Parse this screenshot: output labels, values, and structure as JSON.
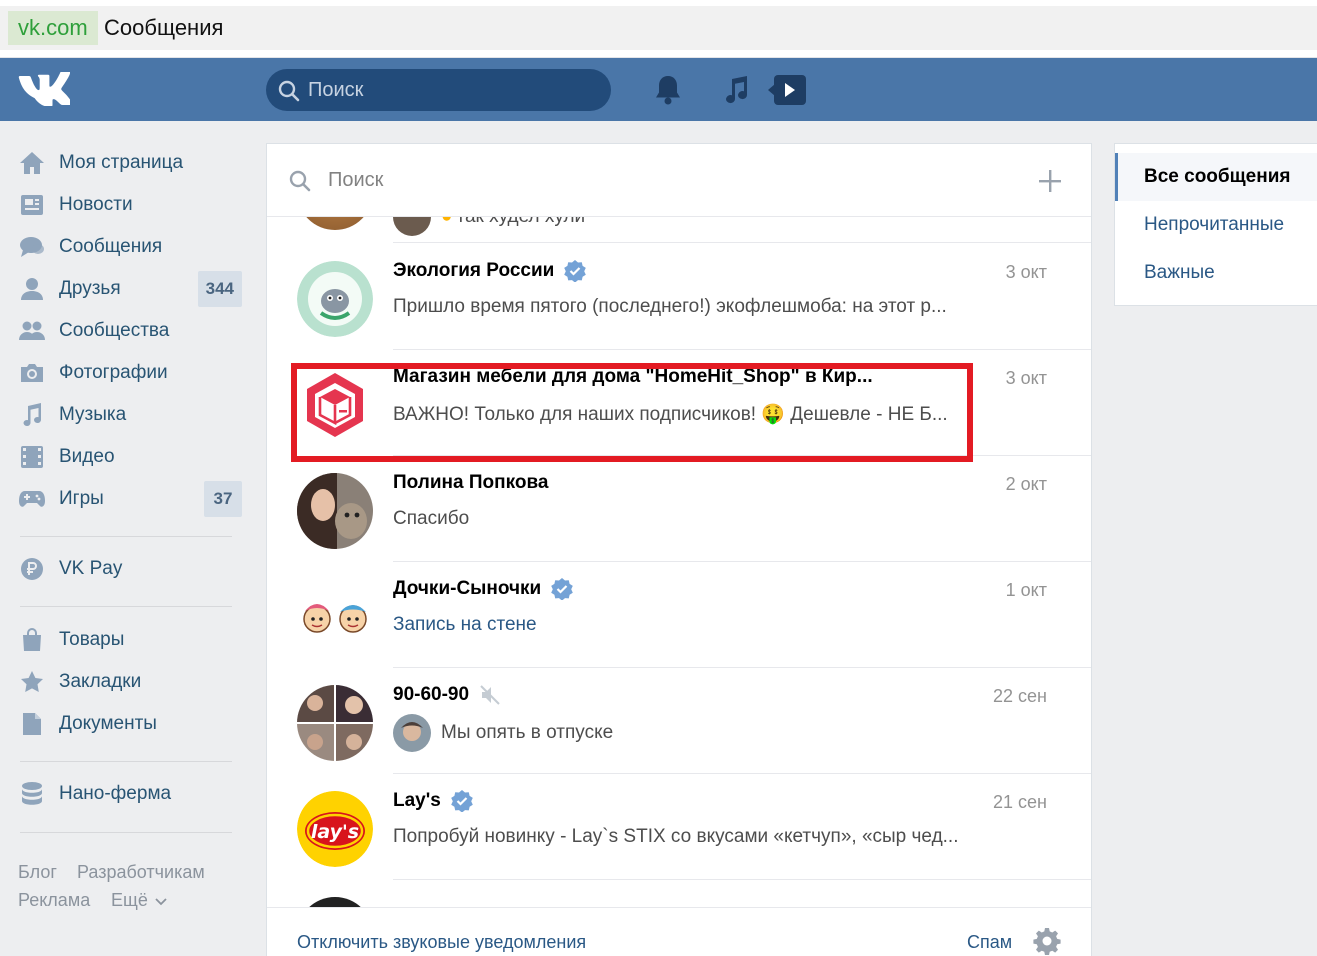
{
  "browser": {
    "domain": "vk.com",
    "page_title": "Сообщения"
  },
  "header": {
    "search_placeholder": "Поиск"
  },
  "nav": {
    "items": [
      {
        "label": "Моя страница",
        "icon": "home-icon"
      },
      {
        "label": "Новости",
        "icon": "news-icon"
      },
      {
        "label": "Сообщения",
        "icon": "messages-icon"
      },
      {
        "label": "Друзья",
        "icon": "friends-icon",
        "count": "344"
      },
      {
        "label": "Сообщества",
        "icon": "communities-icon"
      },
      {
        "label": "Фотографии",
        "icon": "camera-icon"
      },
      {
        "label": "Музыка",
        "icon": "music-icon"
      },
      {
        "label": "Видео",
        "icon": "video-icon"
      },
      {
        "label": "Игры",
        "icon": "gamepad-icon",
        "count": "37"
      }
    ],
    "vkpay": "VK Pay",
    "items2": [
      {
        "label": "Товары",
        "icon": "bag-icon"
      },
      {
        "label": "Закладки",
        "icon": "star-icon"
      },
      {
        "label": "Документы",
        "icon": "document-icon"
      }
    ],
    "nano": "Нано-ферма",
    "footer": {
      "blog": "Блог",
      "developers": "Разработчикам",
      "ads": "Реклама",
      "more": "Ещё"
    }
  },
  "messages": {
    "search_placeholder": "Поиск",
    "partial_top": "так худел хули",
    "dialogs": [
      {
        "name": "Экология России",
        "verified": true,
        "date": "3 окт",
        "preview": "Пришло время пятого (последнего!) экофлешмоба: на этот р..."
      },
      {
        "name": "Магазин мебели для дома \"HomeHit_Shop\" в Кир...",
        "verified": false,
        "date": "3 окт",
        "preview": "ВАЖНО! Только для наших подписчиков! 🤑 Дешевле - НЕ Б..."
      },
      {
        "name": "Полина Попкова",
        "verified": false,
        "date": "2 окт",
        "preview": "Спасибо"
      },
      {
        "name": "Дочки-Сыночки",
        "verified": true,
        "date": "1 окт",
        "preview": "Запись на стене",
        "preview_is_link": true
      },
      {
        "name": "90-60-90",
        "muted": true,
        "date": "22 сен",
        "preview": "Мы опять в отпуске",
        "has_mini_avatar": true
      },
      {
        "name": "Lay's",
        "verified": true,
        "date": "21 сен",
        "preview": "Попробуй новинку - Lay`s STIX со вкусами «кетчуп», «сыр чед..."
      }
    ],
    "footer": {
      "mute_sounds": "Отключить звуковые уведомления",
      "spam": "Спам"
    }
  },
  "filters": {
    "items": [
      "Все сообщения",
      "Непрочитанные",
      "Важные"
    ],
    "active": "Все сообщения"
  },
  "colors": {
    "header_bg": "#4a76a8",
    "link": "#2a5885",
    "highlight": "#e31b23",
    "page_bg": "#edeef0"
  }
}
